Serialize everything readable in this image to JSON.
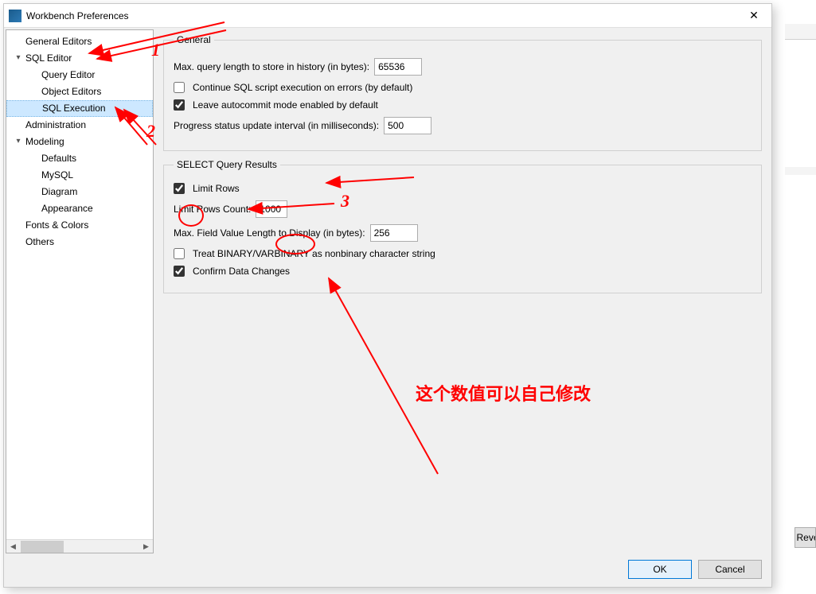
{
  "window": {
    "title": "Workbench Preferences"
  },
  "sidebar": {
    "items": [
      {
        "label": "General Editors",
        "level": "top"
      },
      {
        "label": "SQL Editor",
        "level": "top",
        "expanded": true
      },
      {
        "label": "Query Editor",
        "level": "child"
      },
      {
        "label": "Object Editors",
        "level": "child"
      },
      {
        "label": "SQL Execution",
        "level": "child",
        "selected": true
      },
      {
        "label": "Administration",
        "level": "top"
      },
      {
        "label": "Modeling",
        "level": "top",
        "expanded": true
      },
      {
        "label": "Defaults",
        "level": "child"
      },
      {
        "label": "MySQL",
        "level": "child"
      },
      {
        "label": "Diagram",
        "level": "child"
      },
      {
        "label": "Appearance",
        "level": "child"
      },
      {
        "label": "Fonts & Colors",
        "level": "top"
      },
      {
        "label": "Others",
        "level": "top"
      }
    ]
  },
  "general": {
    "legend": "General",
    "max_query_label": "Max. query length to store in history (in bytes):",
    "max_query_value": "65536",
    "continue_errors_label": "Continue SQL script execution on errors (by default)",
    "continue_errors_checked": false,
    "autocommit_label": "Leave autocommit mode enabled by default",
    "autocommit_checked": true,
    "progress_label": "Progress status update interval (in milliseconds):",
    "progress_value": "500"
  },
  "select_results": {
    "legend": "SELECT Query Results",
    "limit_rows_label": "Limit Rows",
    "limit_rows_checked": true,
    "limit_rows_count_label": "Limit Rows Count:",
    "limit_rows_count_value": "1000",
    "max_field_label": "Max. Field Value Length to Display (in bytes):",
    "max_field_value": "256",
    "treat_binary_label": "Treat BINARY/VARBINARY as nonbinary character string",
    "treat_binary_checked": false,
    "confirm_label": "Confirm Data Changes",
    "confirm_checked": true
  },
  "buttons": {
    "ok": "OK",
    "cancel": "Cancel"
  },
  "annotations": {
    "n1": "1",
    "n2": "2",
    "n3": "3",
    "note": "这个数值可以自己修改"
  },
  "stub": {
    "reve": "Reve"
  }
}
